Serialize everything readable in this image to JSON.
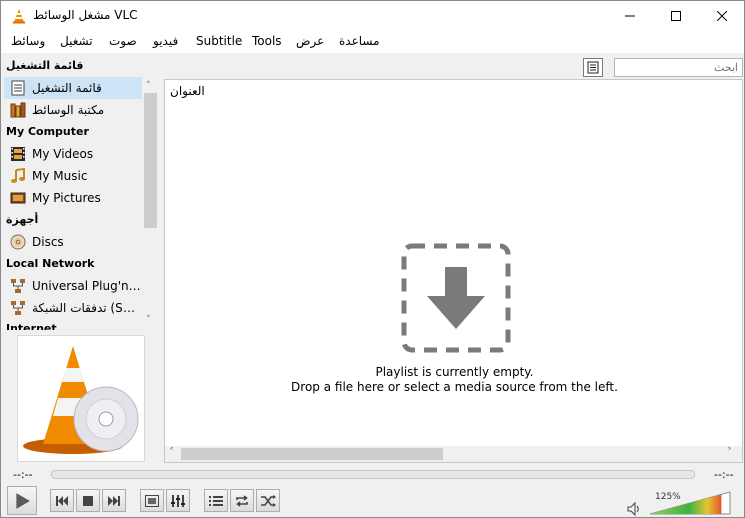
{
  "window": {
    "title": "مشغل الوسائط VLC",
    "minimize": "—",
    "maximize": "☐",
    "close": "✕"
  },
  "menu": [
    "مساعدة",
    "عرض",
    "Tools",
    "Subtitle",
    "فيديو",
    "صوت",
    "تشغيل",
    "وسائط"
  ],
  "sidebar": {
    "sections": [
      {
        "header": "قائمة التشغيل",
        "items": [
          {
            "label": "قائمة التشغيل",
            "icon": "playlist-icon",
            "selected": true
          },
          {
            "label": "مكتبة الوسائط",
            "icon": "media-library-icon"
          }
        ]
      },
      {
        "header": "My Computer",
        "items": [
          {
            "label": "My Videos",
            "icon": "film-icon"
          },
          {
            "label": "My Music",
            "icon": "music-note-icon"
          },
          {
            "label": "My Pictures",
            "icon": "picture-icon"
          }
        ]
      },
      {
        "header": "أجهزة",
        "items": [
          {
            "label": "Discs",
            "icon": "disc-icon"
          }
        ]
      },
      {
        "header": "Local Network",
        "items": [
          {
            "label": "Universal Plug'n'Pl...",
            "icon": "network-icon"
          },
          {
            "label": "تدفقات الشبكة (SAP)",
            "icon": "network-icon"
          }
        ]
      },
      {
        "header": "Internet",
        "items": []
      }
    ]
  },
  "search": {
    "placeholder": "ابحث"
  },
  "playlist": {
    "column_title": "العنوان",
    "empty_line1": "Playlist is currently empty.",
    "empty_line2": "Drop a file here or select a media source from the left."
  },
  "seek": {
    "elapsed": "--:--",
    "remaining": "--:--"
  },
  "volume": {
    "percent": "125%",
    "level": 1.25
  },
  "colors": {
    "selection": "#cce4f7",
    "vlc_orange": "#f08a00"
  }
}
